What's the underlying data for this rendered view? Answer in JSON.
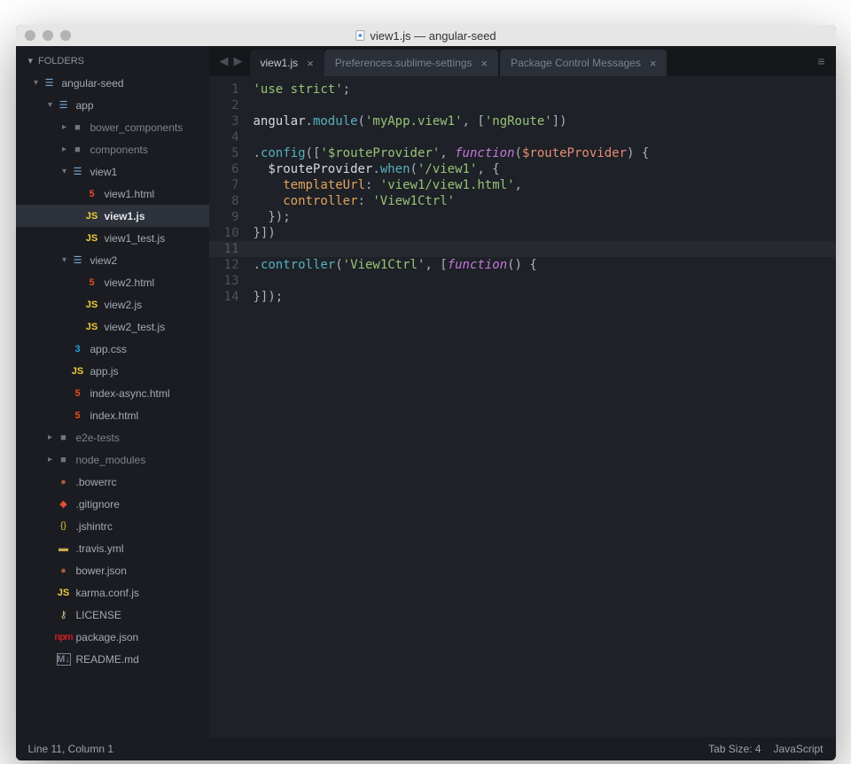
{
  "titlebar": {
    "title": "view1.js — angular-seed"
  },
  "sidebar": {
    "header": "FOLDERS",
    "tree": [
      {
        "label": "angular-seed",
        "kind": "folder-open",
        "depth": 0,
        "chev": "down"
      },
      {
        "label": "app",
        "kind": "folder-open",
        "depth": 1,
        "chev": "down"
      },
      {
        "label": "bower_components",
        "kind": "folder",
        "depth": 2,
        "chev": "right"
      },
      {
        "label": "components",
        "kind": "folder",
        "depth": 2,
        "chev": "right"
      },
      {
        "label": "view1",
        "kind": "folder-open",
        "depth": 2,
        "chev": "down"
      },
      {
        "label": "view1.html",
        "kind": "html",
        "depth": 3
      },
      {
        "label": "view1.js",
        "kind": "js",
        "depth": 3,
        "active": true
      },
      {
        "label": "view1_test.js",
        "kind": "js",
        "depth": 3
      },
      {
        "label": "view2",
        "kind": "folder-open",
        "depth": 2,
        "chev": "down"
      },
      {
        "label": "view2.html",
        "kind": "html",
        "depth": 3
      },
      {
        "label": "view2.js",
        "kind": "js",
        "depth": 3
      },
      {
        "label": "view2_test.js",
        "kind": "js",
        "depth": 3
      },
      {
        "label": "app.css",
        "kind": "css",
        "depth": 2
      },
      {
        "label": "app.js",
        "kind": "js",
        "depth": 2
      },
      {
        "label": "index-async.html",
        "kind": "html",
        "depth": 2
      },
      {
        "label": "index.html",
        "kind": "html",
        "depth": 2
      },
      {
        "label": "e2e-tests",
        "kind": "folder",
        "depth": 1,
        "chev": "right"
      },
      {
        "label": "node_modules",
        "kind": "folder",
        "depth": 1,
        "chev": "right"
      },
      {
        "label": ".bowerrc",
        "kind": "json",
        "depth": 1
      },
      {
        "label": ".gitignore",
        "kind": "git",
        "depth": 1
      },
      {
        "label": ".jshintrc",
        "kind": "jshint",
        "depth": 1
      },
      {
        "label": ".travis.yml",
        "kind": "yml",
        "depth": 1
      },
      {
        "label": "bower.json",
        "kind": "json",
        "depth": 1
      },
      {
        "label": "karma.conf.js",
        "kind": "js",
        "depth": 1
      },
      {
        "label": "LICENSE",
        "kind": "license",
        "depth": 1
      },
      {
        "label": "package.json",
        "kind": "npm",
        "depth": 1
      },
      {
        "label": "README.md",
        "kind": "md",
        "depth": 1
      }
    ]
  },
  "tabs": [
    {
      "label": "view1.js",
      "active": true
    },
    {
      "label": "Preferences.sublime-settings",
      "active": false
    },
    {
      "label": "Package Control Messages",
      "active": false
    }
  ],
  "code": {
    "lines": [
      [
        {
          "t": "'use strict'",
          "c": "str"
        },
        {
          "t": ";",
          "c": "punct"
        }
      ],
      [],
      [
        {
          "t": "angular",
          "c": "id"
        },
        {
          "t": ".",
          "c": "punct"
        },
        {
          "t": "module",
          "c": "fn"
        },
        {
          "t": "(",
          "c": "punct"
        },
        {
          "t": "'myApp.view1'",
          "c": "str"
        },
        {
          "t": ", ",
          "c": "punct"
        },
        {
          "t": "[",
          "c": "punct"
        },
        {
          "t": "'ngRoute'",
          "c": "str"
        },
        {
          "t": "]",
          "c": "punct"
        },
        {
          "t": ")",
          "c": "punct"
        }
      ],
      [],
      [
        {
          "t": ".",
          "c": "punct"
        },
        {
          "t": "config",
          "c": "fn"
        },
        {
          "t": "(",
          "c": "punct"
        },
        {
          "t": "[",
          "c": "punct"
        },
        {
          "t": "'$routeProvider'",
          "c": "str"
        },
        {
          "t": ", ",
          "c": "punct"
        },
        {
          "t": "function",
          "c": "kw"
        },
        {
          "t": "(",
          "c": "punct"
        },
        {
          "t": "$routeProvider",
          "c": "var"
        },
        {
          "t": ") {",
          "c": "punct"
        }
      ],
      [
        {
          "t": "  ",
          "c": "punct"
        },
        {
          "t": "$routeProvider",
          "c": "id"
        },
        {
          "t": ".",
          "c": "punct"
        },
        {
          "t": "when",
          "c": "fn"
        },
        {
          "t": "(",
          "c": "punct"
        },
        {
          "t": "'/view1'",
          "c": "str"
        },
        {
          "t": ", {",
          "c": "punct"
        }
      ],
      [
        {
          "t": "    ",
          "c": "punct"
        },
        {
          "t": "templateUrl",
          "c": "prop"
        },
        {
          "t": ": ",
          "c": "punct"
        },
        {
          "t": "'view1/view1.html'",
          "c": "str"
        },
        {
          "t": ",",
          "c": "punct"
        }
      ],
      [
        {
          "t": "    ",
          "c": "punct"
        },
        {
          "t": "controller",
          "c": "prop"
        },
        {
          "t": ": ",
          "c": "punct"
        },
        {
          "t": "'View1Ctrl'",
          "c": "str"
        }
      ],
      [
        {
          "t": "  });",
          "c": "punct"
        }
      ],
      [
        {
          "t": "}])",
          "c": "punct"
        }
      ],
      [],
      [
        {
          "t": ".",
          "c": "punct"
        },
        {
          "t": "controller",
          "c": "fn"
        },
        {
          "t": "(",
          "c": "punct"
        },
        {
          "t": "'View1Ctrl'",
          "c": "str"
        },
        {
          "t": ", ",
          "c": "punct"
        },
        {
          "t": "[",
          "c": "punct"
        },
        {
          "t": "function",
          "c": "kw"
        },
        {
          "t": "() {",
          "c": "punct"
        }
      ],
      [],
      [
        {
          "t": "}]);",
          "c": "punct"
        }
      ]
    ]
  },
  "status": {
    "left": "Line 11, Column 1",
    "tabsize": "Tab Size: 4",
    "lang": "JavaScript"
  }
}
